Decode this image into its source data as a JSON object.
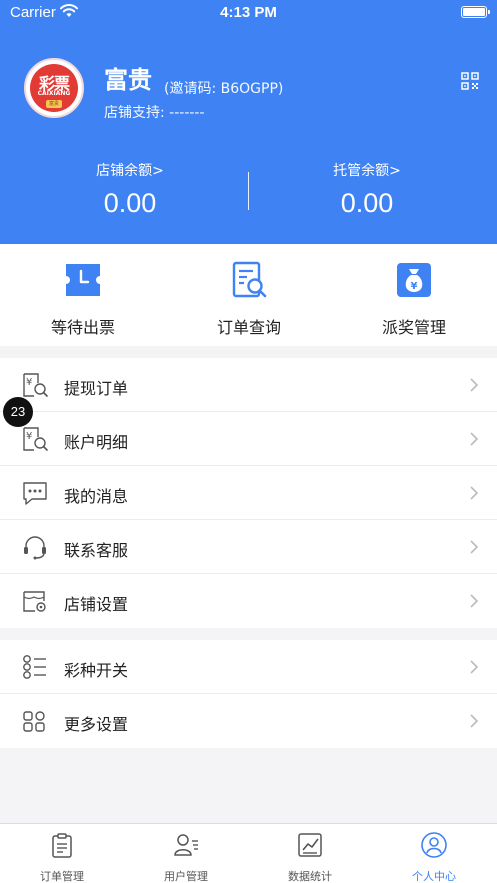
{
  "status": {
    "carrier": "Carrier",
    "time": "4:13 PM"
  },
  "profile": {
    "logo_cn": "彩票",
    "logo_en": "CAIXIANG",
    "logo_tag": "富贵",
    "shop_name": "富贵",
    "invite_code": "(邀请码: B6OGPP)",
    "support": "店铺支持: -------"
  },
  "balances": [
    {
      "label": "店铺余额>",
      "value": "0.00"
    },
    {
      "label": "托管余额>",
      "value": "0.00"
    }
  ],
  "quick_actions": [
    {
      "label": "等待出票",
      "icon": "ticket-clock-icon"
    },
    {
      "label": "订单查询",
      "icon": "order-search-icon"
    },
    {
      "label": "派奖管理",
      "icon": "money-bag-icon"
    }
  ],
  "menu_group_1": [
    {
      "label": "提现订单",
      "icon": "withdraw-order-icon"
    },
    {
      "label": "账户明细",
      "icon": "account-detail-icon"
    },
    {
      "label": "我的消息",
      "icon": "message-icon"
    },
    {
      "label": "联系客服",
      "icon": "headset-icon"
    },
    {
      "label": "店铺设置",
      "icon": "shop-settings-icon"
    }
  ],
  "menu_group_2": [
    {
      "label": "彩种开关",
      "icon": "lottery-switch-icon"
    },
    {
      "label": "更多设置",
      "icon": "more-settings-icon"
    }
  ],
  "badge": "23",
  "tabs": [
    {
      "label": "订单管理",
      "icon": "clipboard-icon"
    },
    {
      "label": "用户管理",
      "icon": "users-icon"
    },
    {
      "label": "数据统计",
      "icon": "chart-icon"
    },
    {
      "label": "个人中心",
      "icon": "person-icon",
      "active": true
    }
  ],
  "colors": {
    "primary": "#3f82f4",
    "logo_red": "#e23a35"
  }
}
